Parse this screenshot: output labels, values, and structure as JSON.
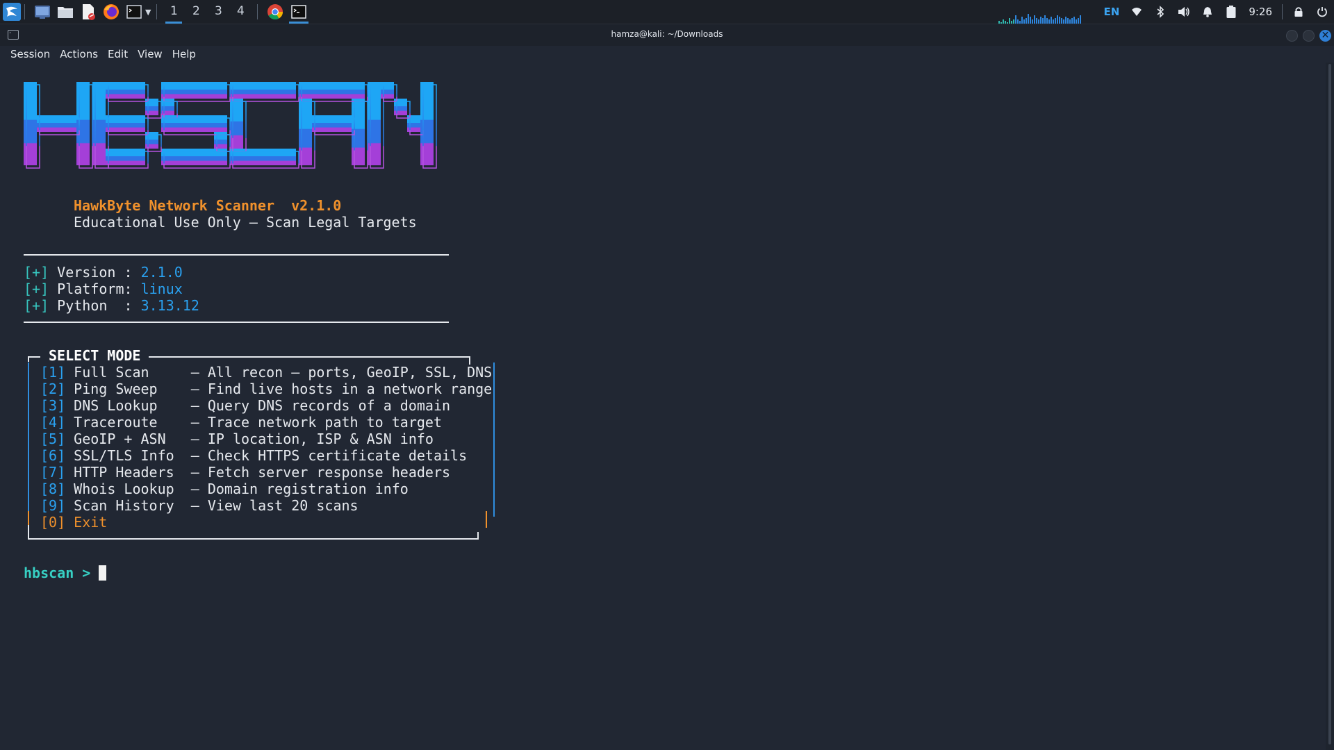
{
  "panel": {
    "workspaces": [
      "1",
      "2",
      "3",
      "4"
    ],
    "active_workspace": "1",
    "language": "EN",
    "clock": "9:26"
  },
  "window": {
    "title": "hamza@kali: ~/Downloads"
  },
  "menubar": {
    "items": [
      "Session",
      "Actions",
      "Edit",
      "View",
      "Help"
    ]
  },
  "terminal": {
    "banner_logo_text": "HBSCAN",
    "app_name": "HawkByte Network Scanner",
    "app_version_tag": "v2.1.0",
    "tagline": "Educational Use Only — Scan Legal Targets",
    "info": [
      {
        "prefix": "[+]",
        "label": "Version :",
        "value": "2.1.0"
      },
      {
        "prefix": "[+]",
        "label": "Platform:",
        "value": "linux"
      },
      {
        "prefix": "[+]",
        "label": "Python  :",
        "value": "3.13.12"
      }
    ],
    "menu_title": "SELECT MODE",
    "menu": [
      {
        "key": "[1]",
        "name": "Full Scan    ",
        "desc": "— All recon — ports, GeoIP, SSL, DNS"
      },
      {
        "key": "[2]",
        "name": "Ping Sweep   ",
        "desc": "— Find live hosts in a network range"
      },
      {
        "key": "[3]",
        "name": "DNS Lookup   ",
        "desc": "— Query DNS records of a domain"
      },
      {
        "key": "[4]",
        "name": "Traceroute   ",
        "desc": "— Trace network path to target"
      },
      {
        "key": "[5]",
        "name": "GeoIP + ASN  ",
        "desc": "— IP location, ISP & ASN info"
      },
      {
        "key": "[6]",
        "name": "SSL/TLS Info ",
        "desc": "— Check HTTPS certificate details"
      },
      {
        "key": "[7]",
        "name": "HTTP Headers ",
        "desc": "— Fetch server response headers"
      },
      {
        "key": "[8]",
        "name": "Whois Lookup ",
        "desc": "— Domain registration info"
      },
      {
        "key": "[9]",
        "name": "Scan History ",
        "desc": "— View last 20 scans"
      }
    ],
    "exit_item": {
      "key": "[0]",
      "name": "Exit"
    },
    "prompt": "hbscan >"
  },
  "colors": {
    "terminal_bg": "#212733",
    "accent_blue": "#2aa1f0",
    "accent_orange": "#f0912c",
    "prompt_teal": "#37d0c4",
    "logo_top": "#1da1f2",
    "logo_mid": "#2f6fe0",
    "logo_bottom": "#a23fd8"
  },
  "icons": [
    "kali-menu-icon",
    "show-desktop-icon",
    "file-manager-icon",
    "text-editor-icon",
    "firefox-icon",
    "terminal-icon",
    "chrome-icon",
    "terminal-active-icon",
    "network-icon",
    "bluetooth-icon",
    "volume-icon",
    "notifications-icon",
    "battery-icon",
    "lock-icon",
    "power-icon"
  ]
}
